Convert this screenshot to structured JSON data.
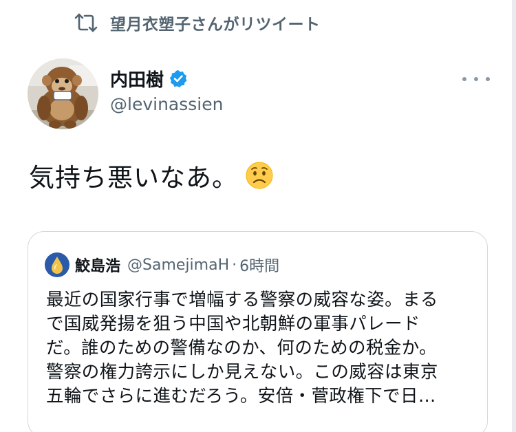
{
  "retweet": {
    "label": "望月衣塑子さんがリツイート",
    "icon": "retweet-icon"
  },
  "author": {
    "name": "内田樹",
    "handle": "@levinassien",
    "verified": true,
    "verified_icon": "verified-badge-icon",
    "avatar": "monkey-plush-avatar"
  },
  "tweet": {
    "text": "気持ち悪いなあ。",
    "emoji": "worried-face-emoji"
  },
  "more_menu": {
    "icon": "more-options-icon"
  },
  "quote": {
    "name": "鮫島浩",
    "handle": "@SamejimaH",
    "separator": "·",
    "time": "6時間",
    "avatar": "water-drop-avatar",
    "lines": [
      "最近の国家行事で増幅する警察の威容な姿。まる",
      "で国威発揚を狙う中国や北朝鮮の軍事パレード",
      "だ。誰のための警備なのか、何のための税金か。",
      "警察の権力誇示にしか見えない。この威容は東京",
      "五輪でさらに進むだろう。安倍・菅政権下で日…"
    ]
  },
  "colors": {
    "text": "#0f1419",
    "secondary": "#536471",
    "verified": "#1d9bf0",
    "border": "#cfd9de"
  }
}
